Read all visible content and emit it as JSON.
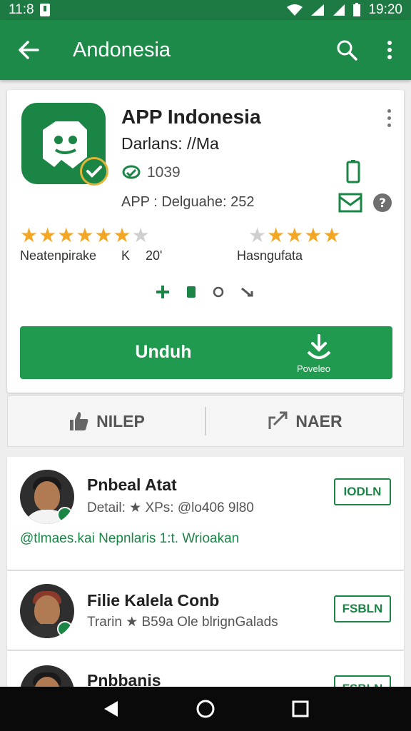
{
  "status_bar": {
    "time_left": "11:8",
    "time_right": "19:20"
  },
  "app_bar": {
    "title": "Andonesia"
  },
  "app": {
    "name": "APP Indonesia",
    "developer": "Darlans: //Ma",
    "downloads": "1039",
    "category": "APP : Delguahe: 252",
    "rating_left": {
      "label": "Neatenpirake",
      "count_a": "K",
      "count_b": "20'",
      "stars": 4.5
    },
    "rating_right": {
      "label": "Hasngufata",
      "stars": 4.5
    },
    "download_label": "Unduh",
    "download_sub": "Poveleo"
  },
  "like_bar": {
    "like_label": "NILEP",
    "share_label": "NAER"
  },
  "list": [
    {
      "name": "Pnbeal Atat",
      "meta": "Detail: ★ XPs: @lo406 9l80",
      "tag": "@tlmaes.kai  Nepnlaris 1:t. Wrioakan",
      "button": "IODLN"
    },
    {
      "name": "Filie Kalela Conb",
      "meta": "Trarin ★ B59a Ole blrignGalads",
      "button": "FSBLN"
    },
    {
      "name": "Pnbbanis",
      "button": "FSBLN"
    }
  ],
  "colors": {
    "primary": "#1e8a4a",
    "accent": "#f2a623"
  }
}
